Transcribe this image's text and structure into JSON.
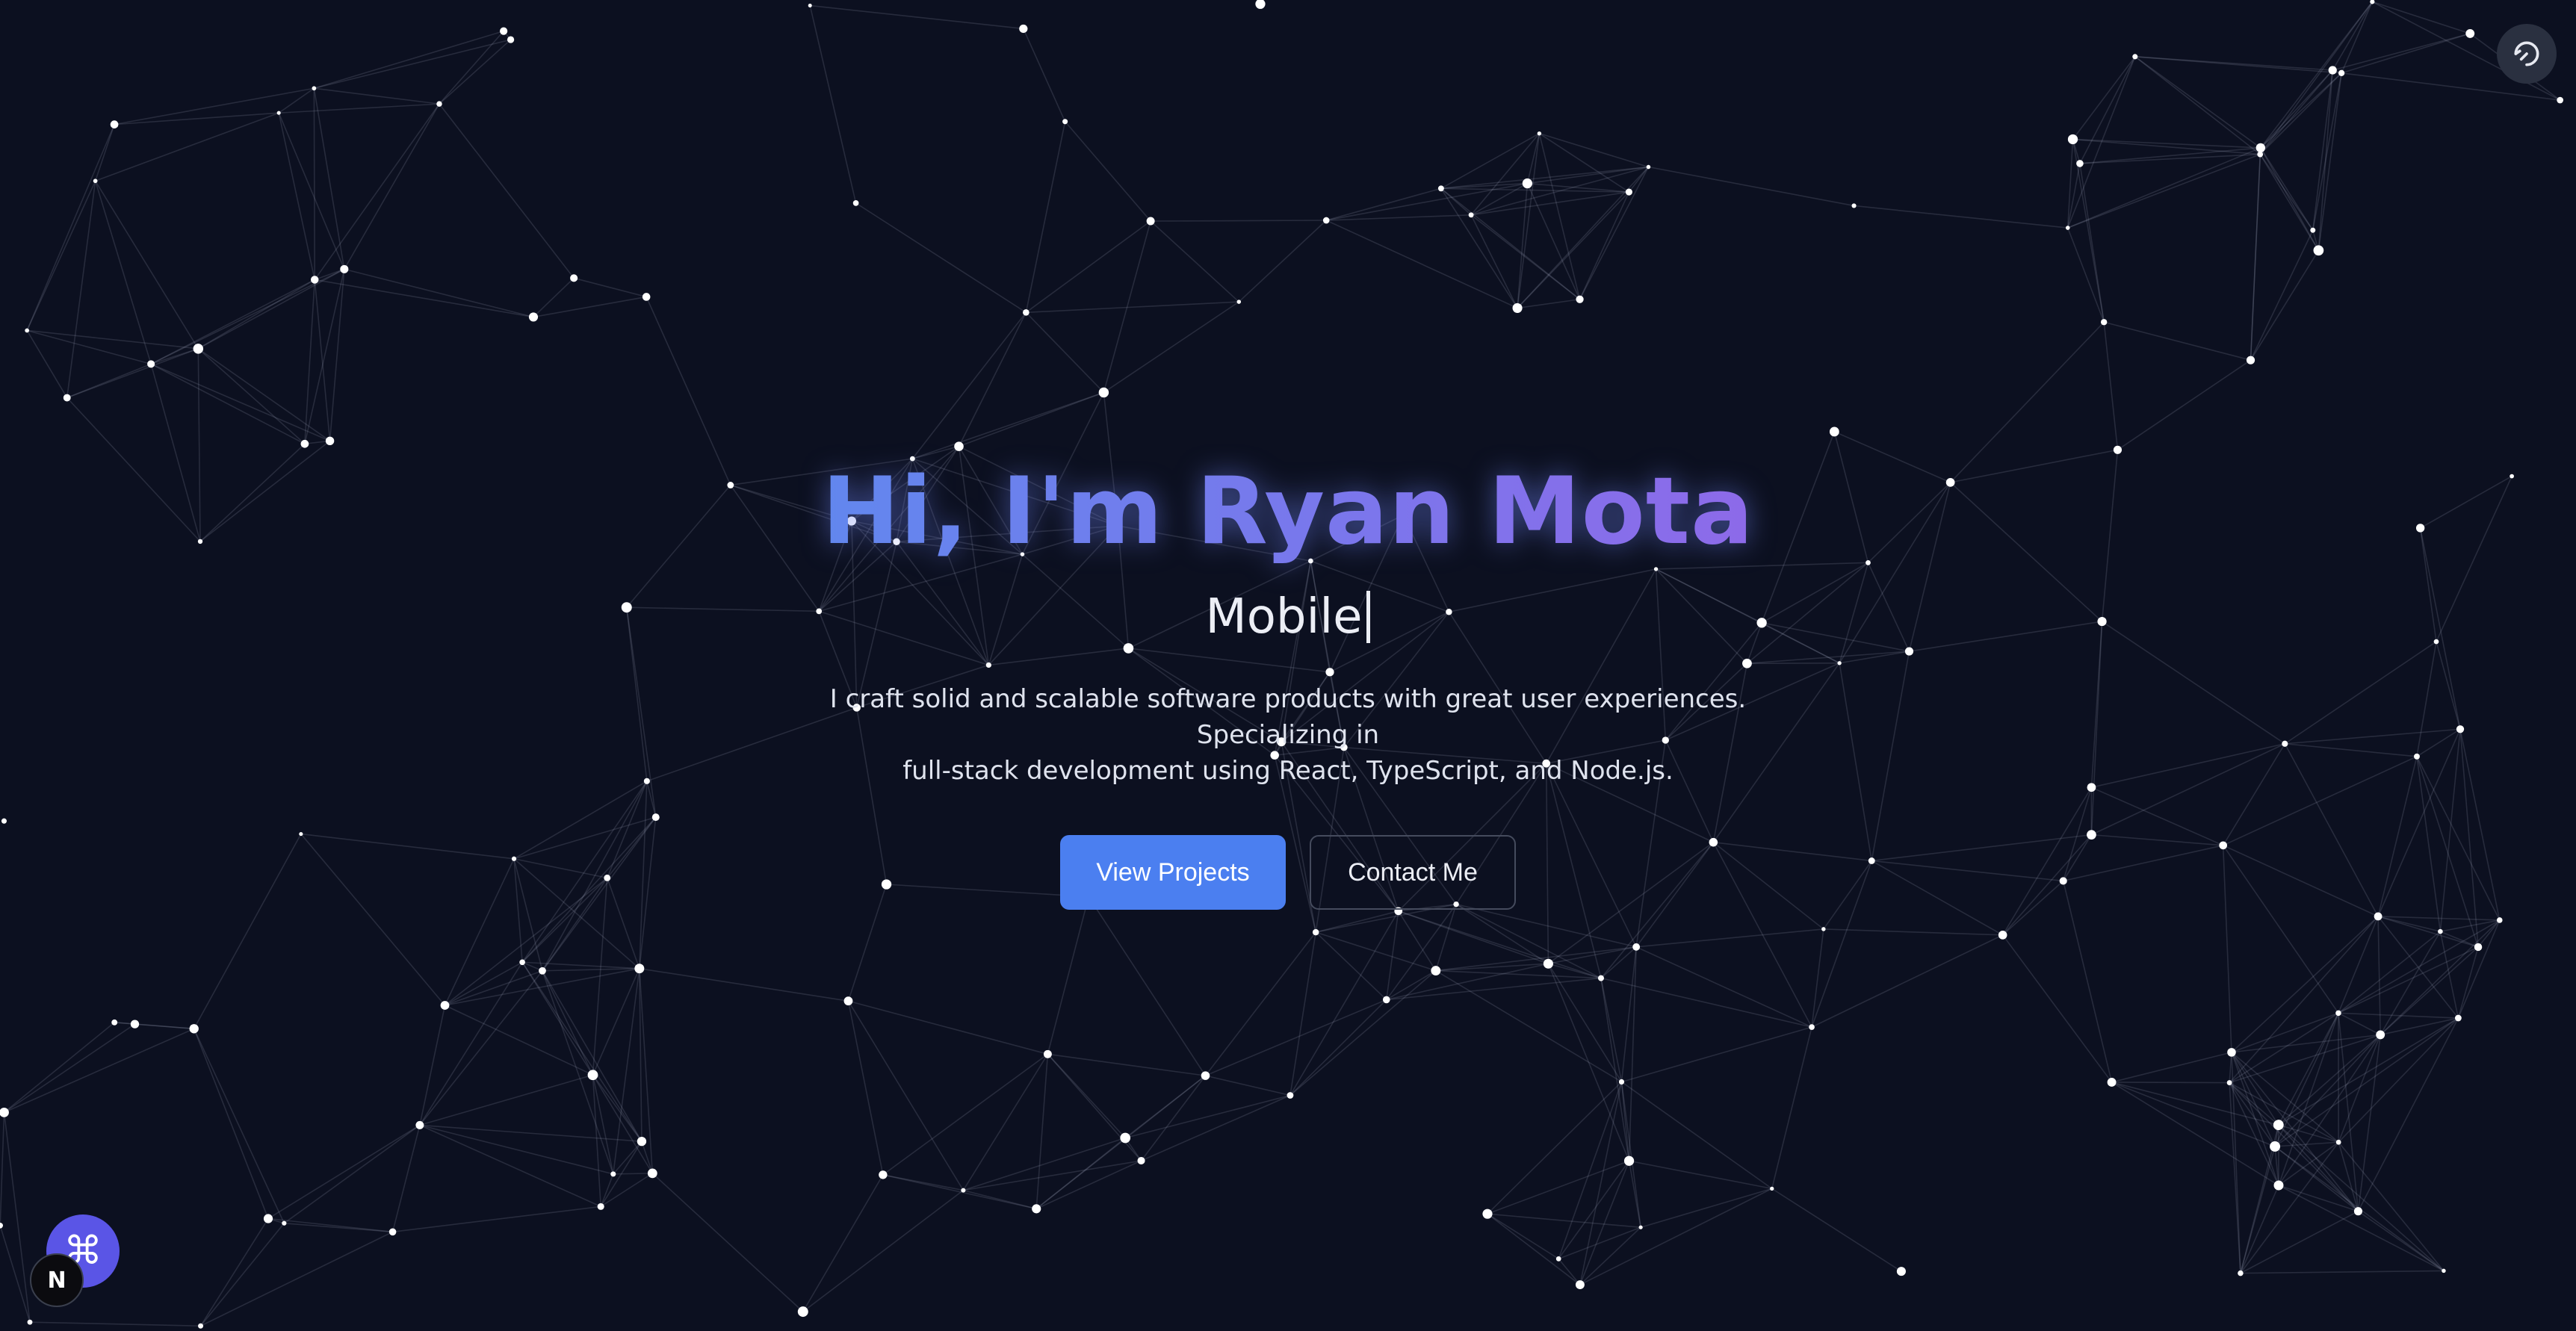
{
  "hero": {
    "title": "Hi, I'm Ryan Mota",
    "typing_text": "Mobile",
    "description_line1": "I craft solid and scalable software products with great user experiences. Specializing in",
    "description_line2": "full-stack development using React, TypeScript, and Node.js."
  },
  "actions": {
    "primary_label": "View Projects",
    "secondary_label": "Contact Me"
  },
  "controls": {
    "top_right_icon": "restore-icon",
    "fab_icon": "command-icon",
    "fab_glyph": "⌘",
    "badge_icon": "nextjs-icon",
    "badge_glyph": "N"
  },
  "colors": {
    "background": "#0c1020",
    "accent": "#4b7ff0",
    "title_gradient_start": "#6287ee",
    "title_gradient_end": "#8d6ae9",
    "fab": "#5a55e6"
  }
}
